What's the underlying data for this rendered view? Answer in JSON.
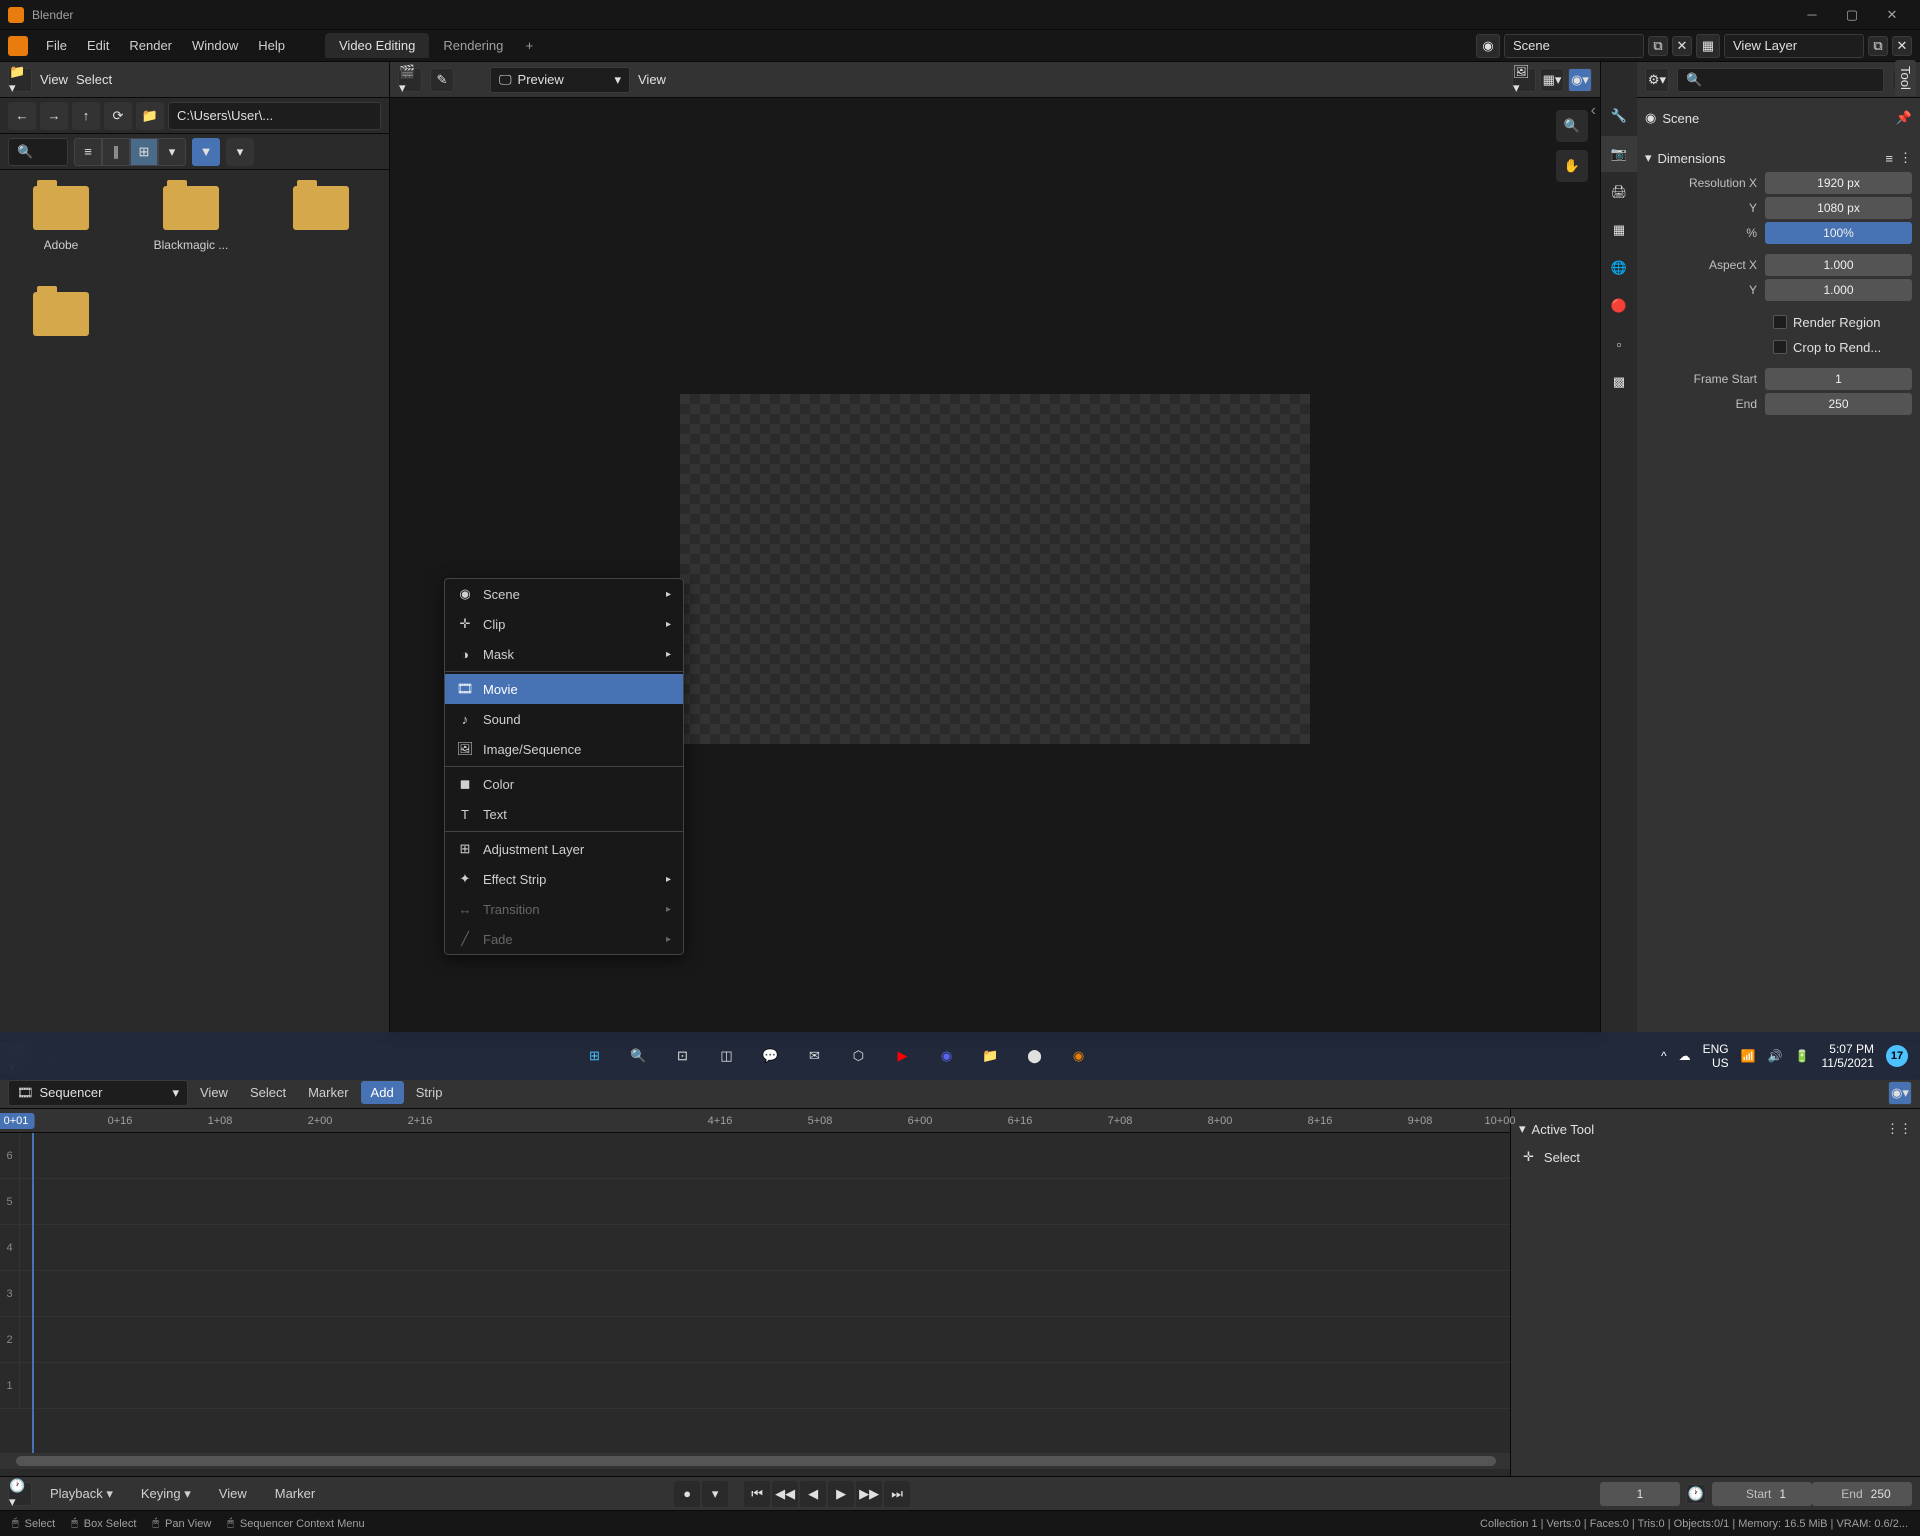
{
  "titlebar": {
    "title": "Blender"
  },
  "menubar": {
    "items": [
      "File",
      "Edit",
      "Render",
      "Window",
      "Help"
    ],
    "tabs": [
      "Video Editing",
      "Rendering"
    ],
    "scene": "Scene",
    "layer": "View Layer"
  },
  "filebrowser": {
    "view_menu": "View",
    "select_menu": "Select",
    "path": "C:\\Users\\User\\...",
    "folders": [
      "Adobe",
      "Blackmagic ...",
      "",
      ""
    ]
  },
  "preview": {
    "mode": "Preview",
    "view_menu": "View"
  },
  "properties": {
    "scene_label": "Scene",
    "dimensions_header": "Dimensions",
    "res_x_label": "Resolution X",
    "res_x": "1920 px",
    "res_y_label": "Y",
    "res_y": "1080 px",
    "pct_label": "%",
    "pct": "100%",
    "aspect_x_label": "Aspect X",
    "aspect_x": "1.000",
    "aspect_y_label": "Y",
    "aspect_y": "1.000",
    "render_region": "Render Region",
    "crop": "Crop to Rend...",
    "frame_start_label": "Frame Start",
    "frame_start": "1",
    "frame_end_label": "End",
    "frame_end": "250"
  },
  "sequencer": {
    "mode": "Sequencer",
    "menus": [
      "View",
      "Select",
      "Marker",
      "Add",
      "Strip"
    ],
    "current_frame": "0+01",
    "ticks": [
      "0+16",
      "1+08",
      "2+00",
      "2+16",
      "4+16",
      "5+08",
      "6+00",
      "6+16",
      "7+08",
      "8+00",
      "8+16",
      "9+08",
      "10+00"
    ],
    "active_tool": "Active Tool",
    "select_tool": "Select",
    "tool_tab": "Tool"
  },
  "add_menu": {
    "items": [
      {
        "label": "Scene",
        "submenu": true
      },
      {
        "label": "Clip",
        "submenu": true
      },
      {
        "label": "Mask",
        "submenu": true
      },
      {
        "label": "Movie",
        "highlight": true
      },
      {
        "label": "Sound"
      },
      {
        "label": "Image/Sequence"
      },
      {
        "label": "Color"
      },
      {
        "label": "Text"
      },
      {
        "label": "Adjustment Layer"
      },
      {
        "label": "Effect Strip",
        "submenu": true
      },
      {
        "label": "Transition",
        "disabled": true,
        "submenu": true
      },
      {
        "label": "Fade",
        "disabled": true,
        "submenu": true
      }
    ]
  },
  "playback": {
    "playback_menu": "Playback",
    "keying_menu": "Keying",
    "view_menu": "View",
    "marker_menu": "Marker",
    "frame": "1",
    "start_label": "Start",
    "start": "1",
    "end_label": "End",
    "end": "250"
  },
  "statusbar": {
    "select": "Select",
    "box_select": "Box Select",
    "pan": "Pan View",
    "context": "Sequencer Context Menu",
    "stats": "Collection 1 | Verts:0 | Faces:0 | Tris:0 | Objects:0/1 | Memory: 16.5 MiB | VRAM: 0.6/2..."
  },
  "taskbar": {
    "lang": "ENG",
    "region": "US",
    "time": "5:07 PM",
    "date": "11/5/2021",
    "badge": "17"
  }
}
